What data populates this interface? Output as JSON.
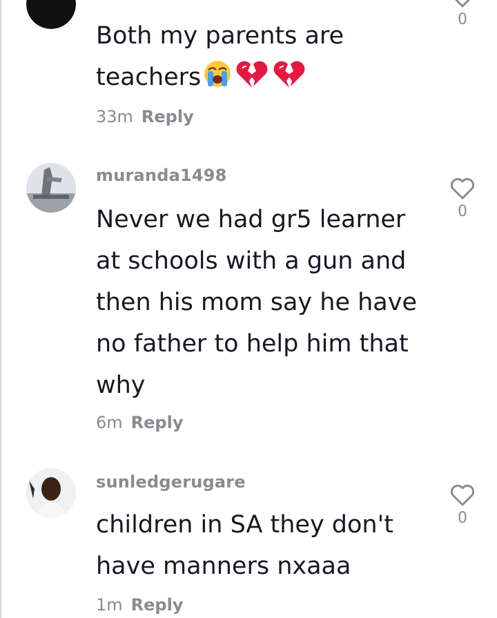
{
  "comments": [
    {
      "username": "",
      "text_line1": "Both my parents are",
      "text_line2": "teachers",
      "time": "33m",
      "reply_label": "Reply",
      "likes": "0",
      "emojis": [
        "loudly-crying-face",
        "broken-heart",
        "broken-heart"
      ]
    },
    {
      "username": "muranda1498",
      "text": "Never we had gr5 learner at schools with a gun and then his mom say he have no father to help him that why",
      "time": "6m",
      "reply_label": "Reply",
      "likes": "0"
    },
    {
      "username": "sunledgerugare",
      "text": "children in SA they don't have manners nxaaa",
      "time": "1m",
      "reply_label": "Reply",
      "likes": "0"
    }
  ],
  "colors": {
    "text": "#161823",
    "secondary": "#8a8b91",
    "broken_heart": "#e5193f",
    "crying_face": "#ffc93c"
  }
}
